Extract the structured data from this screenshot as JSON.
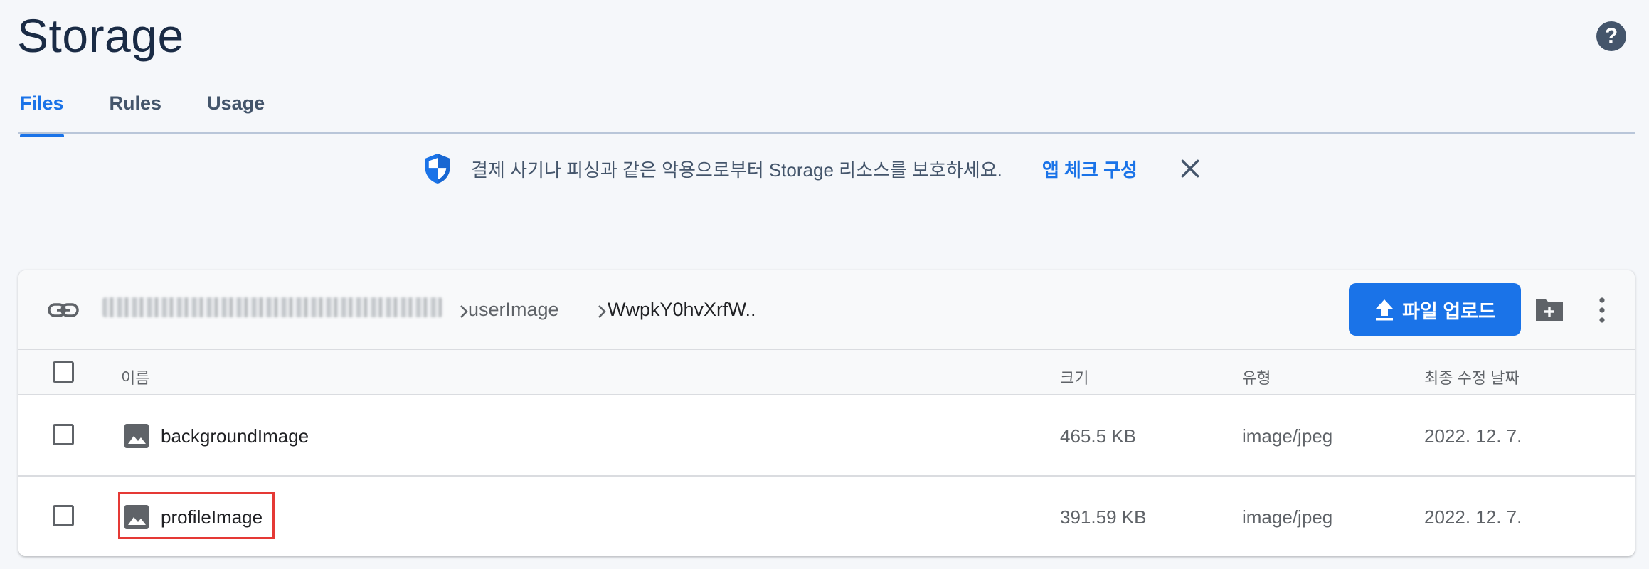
{
  "page_title": "Storage",
  "tabs": [
    {
      "label": "Files",
      "active": true
    },
    {
      "label": "Rules",
      "active": false
    },
    {
      "label": "Usage",
      "active": false
    }
  ],
  "banner": {
    "text": "결제 사기나 피싱과 같은 악용으로부터 Storage 리소스를 보호하세요.",
    "link": "앱 체크 구성"
  },
  "breadcrumb": {
    "segments": [
      "userImage",
      "WwpkY0hvXrfW.."
    ]
  },
  "toolbar": {
    "upload_label": "파일 업로드"
  },
  "table": {
    "columns": [
      "이름",
      "크기",
      "유형",
      "최종 수정 날짜"
    ],
    "rows": [
      {
        "name": "backgroundImage",
        "size": "465.5 KB",
        "type": "image/jpeg",
        "modified": "2022. 12. 7."
      },
      {
        "name": "profileImage",
        "size": "391.59 KB",
        "type": "image/jpeg",
        "modified": "2022. 12. 7."
      }
    ]
  },
  "colors": {
    "accent": "#1a73e8",
    "title": "#1a2b45",
    "highlight": "#e53935"
  },
  "icons": [
    "help-icon",
    "shield-icon",
    "close-icon",
    "link-icon",
    "chevron-right-icon",
    "upload-icon",
    "new-folder-icon",
    "more-vert-icon",
    "image-file-icon"
  ]
}
